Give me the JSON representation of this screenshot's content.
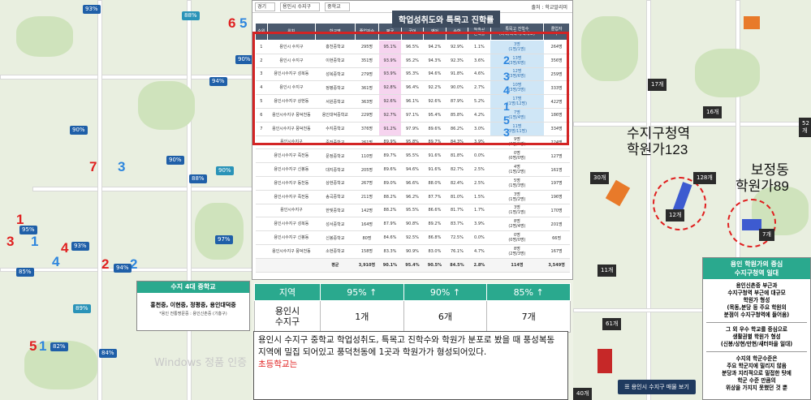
{
  "filters": {
    "region": "경기",
    "city": "용인시 수지구",
    "level": "중학교",
    "source": "출처 : 학교알리미"
  },
  "table_title": "학업성취도와 특목고 진학률",
  "columns": [
    "순위",
    "위치",
    "학교명",
    "졸업자수",
    "평균",
    "국어",
    "영어",
    "수학",
    "특목고\n진학률",
    "특목고 진학수\n(과학/외국어/국제고)",
    "졸업자\n수"
  ],
  "rows": [
    [
      "1",
      "용인시 수지구",
      "홍천중학교",
      "295명",
      "95.1%",
      "96.5%",
      "94.2%",
      "92.9%",
      "1.1%",
      "3명\n(1명/1명)",
      "264명"
    ],
    [
      "2",
      "용인시 수지구",
      "이현중학교",
      "351명",
      "93.9%",
      "95.2%",
      "94.3%",
      "92.3%",
      "3.6%",
      "13명\n(3명/6명)",
      "356명"
    ],
    [
      "3",
      "용인시수지구 성복동",
      "성복중학교",
      "279명",
      "93.9%",
      "95.3%",
      "94.6%",
      "91.8%",
      "4.6%",
      "12명\n(3명/6명)",
      "259명"
    ],
    [
      "4",
      "용인시 수지구",
      "정평중학교",
      "361명",
      "92.8%",
      "96.4%",
      "92.2%",
      "90.0%",
      "2.7%",
      "10명\n(3명/3명)",
      "333명"
    ],
    [
      "5",
      "용인시수지구 상현동",
      "서원중학교",
      "363명",
      "92.6%",
      "96.1%",
      "92.6%",
      "87.9%",
      "5.2%",
      "17명\n(1명/12명)",
      "422명"
    ],
    [
      "6",
      "용인시수지구 풍덕천동",
      "용인대덕중학교",
      "229명",
      "92.7%",
      "97.1%",
      "95.4%",
      "85.8%",
      "4.2%",
      "7명\n(1명/4명)",
      "186명"
    ],
    [
      "7",
      "용인시수지구 풍덕천동",
      "수지중학교",
      "376명",
      "91.2%",
      "97.9%",
      "89.6%",
      "86.2%",
      "3.0%",
      "11명\n(3명/11명)",
      "334명"
    ],
    [
      "",
      "용인시수지구",
      "죽전중학교",
      "261명",
      "89.9%",
      "95.8%",
      "89.7%",
      "84.3%",
      "3.9%",
      "9명\n(3명/1명)",
      "224명"
    ],
    [
      "",
      "용인시수지구 죽전동",
      "문정중학교",
      "110명",
      "89.7%",
      "95.5%",
      "91.6%",
      "81.8%",
      "0.0%",
      "0명\n(0명/0명)",
      "127명"
    ],
    [
      "",
      "용인시수지구 신봉동",
      "대지중학교",
      "205명",
      "89.6%",
      "94.6%",
      "91.6%",
      "82.7%",
      "2.5%",
      "4명\n(1명/2명)",
      "161명"
    ],
    [
      "",
      "용인시수지구 동천동",
      "상현중학교",
      "267명",
      "89.0%",
      "96.6%",
      "88.0%",
      "82.4%",
      "2.5%",
      "5명\n(1명/3명)",
      "197명"
    ],
    [
      "",
      "용인시수지구 죽전동",
      "송곡중학교",
      "211명",
      "88.2%",
      "96.2%",
      "87.7%",
      "81.0%",
      "1.5%",
      "3명\n(1명/2명)",
      "196명"
    ],
    [
      "",
      "용인시수지구",
      "한빛중학교",
      "142명",
      "88.2%",
      "95.5%",
      "86.6%",
      "81.7%",
      "1.7%",
      "3명\n(1명/1명)",
      "170명"
    ],
    [
      "",
      "용인시수지구 성복동",
      "성서중학교",
      "164명",
      "87.9%",
      "90.8%",
      "89.2%",
      "83.7%",
      "3.9%",
      "8명\n(2명/4명)",
      "201명"
    ],
    [
      "",
      "용인시수지구 신봉동",
      "신봉중학교",
      "80명",
      "84.6%",
      "92.5%",
      "86.8%",
      "72.5%",
      "0.0%",
      "0명\n(0명/0명)",
      "66명"
    ],
    [
      "",
      "용인시수지구 풍덕천동",
      "소현중학교",
      "158명",
      "83.3%",
      "90.9%",
      "83.0%",
      "76.1%",
      "4.7%",
      "8명\n(2명/3명)",
      "167명"
    ],
    [
      "",
      "",
      "평균",
      "3,910명",
      "90.1%",
      "95.4%",
      "90.5%",
      "84.5%",
      "2.8%",
      "114명",
      "3,549명"
    ]
  ],
  "ranks": [
    "2",
    "3",
    "4",
    "1",
    "5",
    "3"
  ],
  "summary": {
    "headers": [
      "지역",
      "95% ↑",
      "90% ↑",
      "85% ↑"
    ],
    "row": [
      "용인시\n수지구",
      "1개",
      "6개",
      "7개"
    ]
  },
  "description": "용인시 수지구 중학교 학업성취도, 특목고 진학수와 학원가 분포로 봤을 때 풍성복동 지역에 밀집 되어있고 풍덕천동에 1곳과 학원가가 형성되어있다.",
  "description_red": "초등학교는",
  "middle_box": {
    "title": "수지 4대 중학교",
    "schools": "홍천중, 이현중, 정평중, 용인대덕중",
    "note": "*용인 전통명문중 : 용인신촌중 (기흥구)"
  },
  "right_box": {
    "title": "용인 학원가의 중심\n수지구청역 일대",
    "p1": "용인신촌중 부근과\n수지구청역 부근에 대규모\n학원가 형성\n(목동,분당 등 주요 학원의\n분점이 수지구청역에 들어옴)",
    "p2": "그 외 우수 학교를 중심으로\n생활권별 학원가 형성\n(신봉/상현/만현/새터마을 일대)",
    "p3": "수지의 학군수준은\n주요 학군지에 밀리지 않음\n분당과 지리적으로 밀접한 탓에\n학군 수준 만큼의\n위상을 가지지 못했던 것 뿐"
  },
  "view_button": "☰ 용인시 수지구 매물 보기",
  "watermark": "Windows 정품 인증",
  "map_left": {
    "numbers": [
      {
        "t": "6",
        "c": "red"
      },
      {
        "t": "5",
        "c": "blue"
      },
      {
        "t": "7",
        "c": "red"
      },
      {
        "t": "3",
        "c": "blue"
      },
      {
        "t": "1",
        "c": "red"
      },
      {
        "t": "3",
        "c": "red"
      },
      {
        "t": "1",
        "c": "blue"
      },
      {
        "t": "4",
        "c": "red"
      },
      {
        "t": "4",
        "c": "blue"
      },
      {
        "t": "2",
        "c": "red"
      },
      {
        "t": "2",
        "c": "blue"
      },
      {
        "t": "5",
        "c": "red"
      },
      {
        "t": "1",
        "c": "blue"
      }
    ],
    "pins": [
      "93%",
      "88%",
      "90%",
      "94%",
      "90%",
      "90%",
      "88%",
      "90%",
      "95%",
      "93%",
      "94%",
      "97%",
      "85%",
      "89%",
      "82%",
      "84%"
    ]
  },
  "map_right": {
    "label1": "수지구청역\n학원가123",
    "label2": "보정동\n학원가89",
    "counts": [
      "17개",
      "16개",
      "52개",
      "30개",
      "128개",
      "12개",
      "11개",
      "7개",
      "61개",
      "40개"
    ]
  }
}
